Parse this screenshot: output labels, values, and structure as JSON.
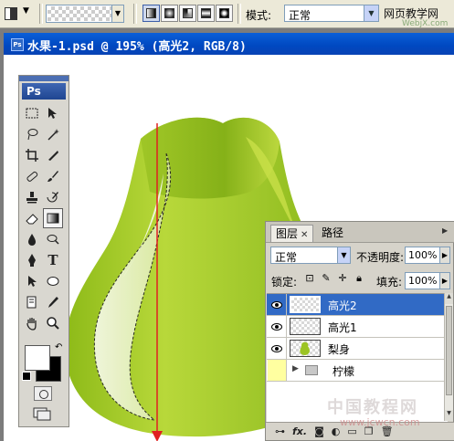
{
  "options_bar": {
    "tool_icon": "gradient-tool-icon",
    "gradient_types": [
      "linear",
      "radial",
      "angle",
      "reflected",
      "diamond"
    ],
    "mode_label": "模式:",
    "mode_value": "正常",
    "site_text": "网页教学网",
    "site_sub": "WebjX.com"
  },
  "document": {
    "title": "水果-1.psd @ 195% (高光2, RGB/8)"
  },
  "toolbox": {
    "logo": "Ps",
    "tools": [
      "marquee",
      "move",
      "lasso",
      "magic-wand",
      "crop",
      "slice",
      "healing",
      "brush",
      "stamp",
      "history-brush",
      "eraser",
      "gradient",
      "blur",
      "dodge",
      "pen",
      "type",
      "path-select",
      "shape",
      "notes",
      "eyedropper",
      "hand",
      "zoom"
    ],
    "foreground_color": "#ffffff",
    "background_color": "#000000"
  },
  "layers_panel": {
    "tab_layers": "图层",
    "tab_paths": "路径",
    "blend_mode": "正常",
    "opacity_label": "不透明度:",
    "opacity_value": "100%",
    "lock_label": "锁定:",
    "fill_label": "填充:",
    "fill_value": "100%",
    "layers": [
      {
        "name": "高光2",
        "selected": true
      },
      {
        "name": "高光1",
        "selected": false
      },
      {
        "name": "梨身",
        "selected": false
      },
      {
        "name": "柠檬",
        "selected": false,
        "group": true
      }
    ],
    "footer_fx": "fx."
  },
  "colors": {
    "title_bar": "#0a5fd9",
    "selection": "#316ac5",
    "pear_light": "#c8e04a",
    "pear_dark": "#7fae12",
    "guide_line": "#e02020"
  },
  "watermark": {
    "text": "中国教程网",
    "url": "www.jcwcn.com"
  }
}
